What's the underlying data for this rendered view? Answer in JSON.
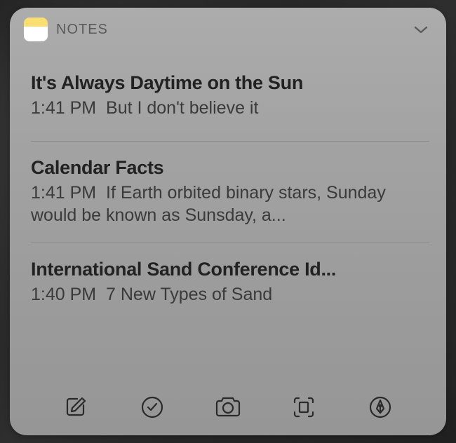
{
  "header": {
    "app_title": "NOTES"
  },
  "notes": [
    {
      "title": "It's Always Daytime on the Sun",
      "time": "1:41 PM",
      "preview": "But I don't believe it"
    },
    {
      "title": "Calendar Facts",
      "time": "1:41 PM",
      "preview": "If Earth orbited binary stars, Sunday would be known as Sunsday, a..."
    },
    {
      "title": "International Sand Conference Id...",
      "time": "1:40 PM",
      "preview": "7 New Types of Sand"
    }
  ],
  "icons": {
    "app_icon": "notes-app-icon",
    "collapse": "chevron-down-icon",
    "compose": "compose-icon",
    "checklist": "check-circle-icon",
    "camera": "camera-icon",
    "scan": "scan-document-icon",
    "draw": "pen-tip-icon"
  }
}
